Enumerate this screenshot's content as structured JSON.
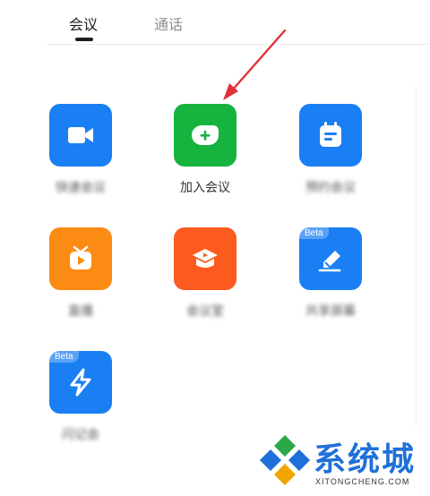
{
  "tabs": {
    "meeting_label": "会议",
    "call_label": "通话"
  },
  "tiles": [
    {
      "label": "快速会议",
      "color": "#1a7ff2",
      "icon": "video-camera-icon",
      "blurred": true
    },
    {
      "label": "加入会议",
      "color": "#16b33f",
      "icon": "join-plus-icon",
      "blurred": false
    },
    {
      "label": "预约会议",
      "color": "#1a7ff2",
      "icon": "calendar-icon",
      "blurred": true
    },
    {
      "label": "直播",
      "color": "#fb8b12",
      "icon": "tv-play-icon",
      "blurred": true
    },
    {
      "label": "会议室",
      "color": "#fc5a1f",
      "icon": "graduation-play-icon",
      "blurred": true
    },
    {
      "label": "共享屏幕",
      "color": "#1a7ff2",
      "icon": "pen-edit-icon",
      "blurred": true,
      "badge": "Beta"
    },
    {
      "label": "闪记会",
      "color": "#1a7ff2",
      "icon": "lightning-icon",
      "blurred": true,
      "badge": "Beta"
    }
  ],
  "watermark": {
    "title": "系统城",
    "domain": "XITONGCHENG.COM"
  },
  "colors": {
    "arrow": "#e0313a",
    "accent_blue": "#1a7ff2"
  }
}
